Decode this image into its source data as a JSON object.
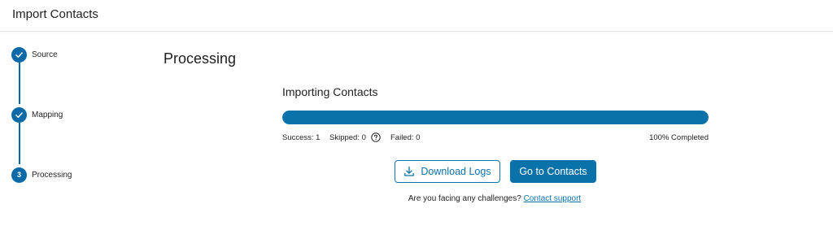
{
  "header": {
    "title": "Import Contacts"
  },
  "steps": [
    {
      "label": "Source",
      "state": "done",
      "icon": "check-icon"
    },
    {
      "label": "Mapping",
      "state": "done",
      "icon": "check-icon"
    },
    {
      "label": "Processing",
      "state": "current",
      "number": "3"
    }
  ],
  "main": {
    "title": "Processing",
    "subtitle": "Importing Contacts"
  },
  "progress": {
    "percent": 100,
    "success": "Success: 1",
    "skipped": "Skipped: 0",
    "failed": "Failed: 0",
    "completed": "100% Completed"
  },
  "actions": {
    "download_logs": "Download Logs",
    "go_to_contacts": "Go to Contacts"
  },
  "help": {
    "text": "Are you facing any challenges?",
    "link": "Contact support"
  },
  "colors": {
    "accent": "#0a72ab",
    "step": "#0a6aa8"
  }
}
